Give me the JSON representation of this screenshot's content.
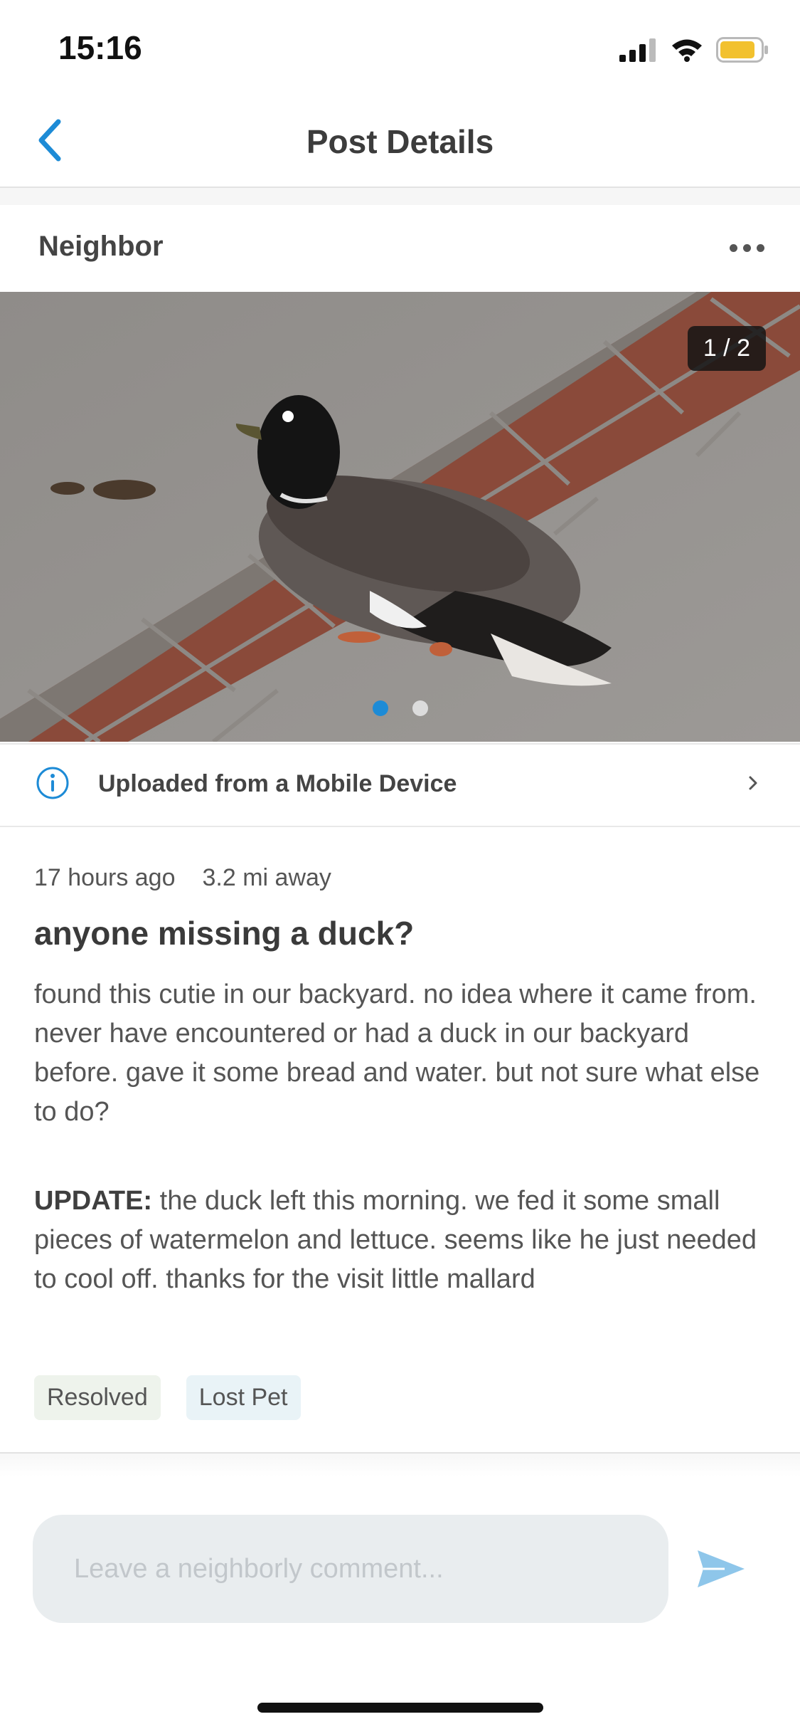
{
  "status_bar": {
    "time": "15:16"
  },
  "nav": {
    "title": "Post Details"
  },
  "author": {
    "name": "Neighbor"
  },
  "photo": {
    "counter": "1 / 2",
    "pages": 2,
    "active_page": 1
  },
  "upload": {
    "label": "Uploaded from a Mobile Device"
  },
  "post": {
    "time_ago": "17 hours ago",
    "distance": "3.2 mi away",
    "title": "anyone missing a duck?",
    "body": "found this cutie in our backyard. no idea where it came from. never have encountered or had a duck in our backyard before. gave it some bread and water. but not sure what else to do?",
    "update_label": "UPDATE:",
    "update_text": "the duck left this morning. we fed it some small pieces of watermelon and lettuce. seems like he just needed to cool off. thanks for the visit little mallard"
  },
  "tags": [
    "Resolved",
    "Lost Pet"
  ],
  "comment": {
    "placeholder": "Leave a neighborly comment..."
  },
  "colors": {
    "accent": "#1d8bd6",
    "send": "#8ec6ea",
    "resolved_bg": "#eef3ec",
    "lost_bg": "#e9f3f7"
  }
}
